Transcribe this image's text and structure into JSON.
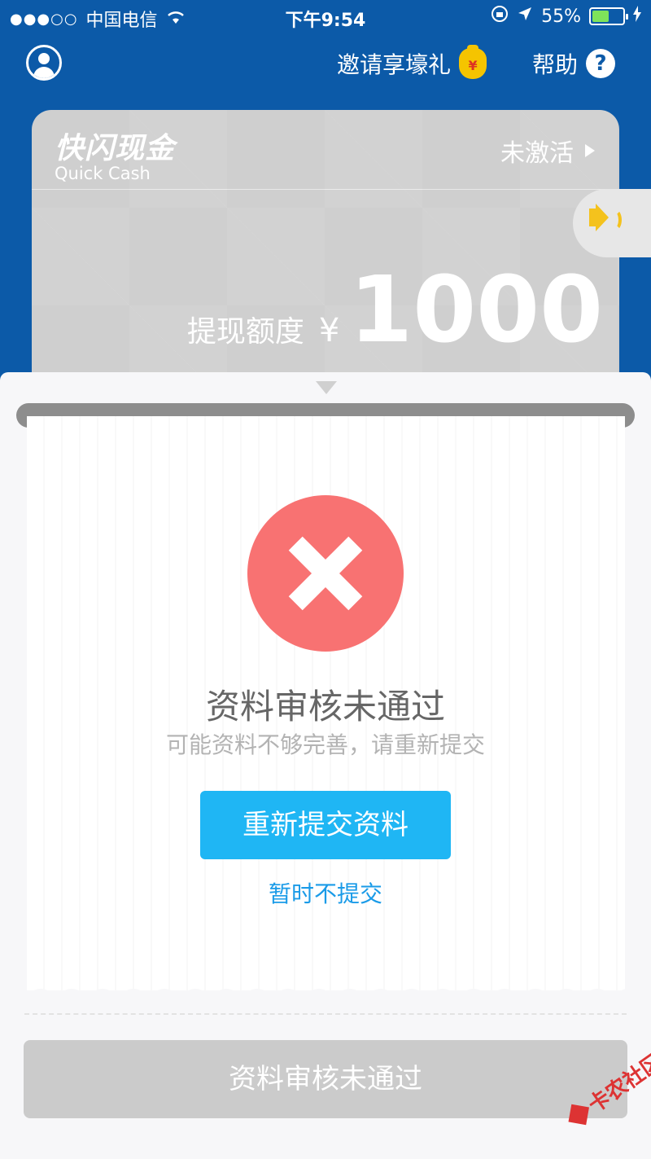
{
  "status_bar": {
    "signal_dots": "●●●○○",
    "carrier": "中国电信",
    "wifi_icon": "wifi-icon",
    "time": "下午9:54",
    "battery_percent": "55%",
    "battery_level": 0.55
  },
  "nav": {
    "invite_label": "邀请享壕礼",
    "moneybag_glyph": "¥",
    "help_label": "帮助",
    "help_glyph": "?"
  },
  "card": {
    "brand_cn": "快闪现金",
    "brand_en": "Quick Cash",
    "activate_label": "未激活",
    "limit_label": "提现额度",
    "currency": "¥",
    "amount": "1000"
  },
  "result": {
    "title": "资料审核未通过",
    "subtitle": "可能资料不够完善，请重新提交",
    "resubmit_button": "重新提交资料",
    "later_link": "暂时不提交"
  },
  "bottom_button": "资料审核未通过",
  "watermark": "卡农社区",
  "colors": {
    "header_blue": "#0c5aa8",
    "error_red": "#f87272",
    "button_blue": "#1fb6f4",
    "link_blue": "#1a9be8"
  }
}
